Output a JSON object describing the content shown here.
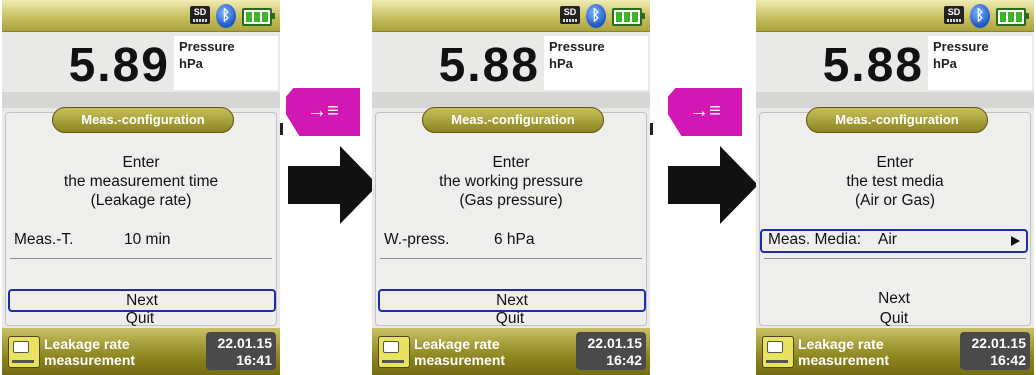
{
  "screens": [
    {
      "reading": "5.89",
      "unit_label": "Pressure",
      "unit": "hPa",
      "dialog_title": "Meas.-configuration",
      "prompt_lines": [
        "Enter",
        "the measurement time",
        "(Leakage rate)"
      ],
      "field_label": "Meas.-T.",
      "field_value": "10 min",
      "selected": "next",
      "next_label": "Next",
      "quit_label": "Quit",
      "footer_title_1": "Leakage rate",
      "footer_title_2": "measurement",
      "date": "22.01.15",
      "time": "16:41"
    },
    {
      "reading": "5.88",
      "unit_label": "Pressure",
      "unit": "hPa",
      "dialog_title": "Meas.-configuration",
      "prompt_lines": [
        "Enter",
        "the working pressure",
        "(Gas pressure)"
      ],
      "field_label": "W.-press.",
      "field_value": "6 hPa",
      "selected": "next",
      "next_label": "Next",
      "quit_label": "Quit",
      "footer_title_1": "Leakage rate",
      "footer_title_2": "measurement",
      "date": "22.01.15",
      "time": "16:42"
    },
    {
      "reading": "5.88",
      "unit_label": "Pressure",
      "unit": "hPa",
      "dialog_title": "Meas.-configuration",
      "prompt_lines": [
        "Enter",
        "the test media",
        "(Air or Gas)"
      ],
      "field_label": "Meas. Media:",
      "field_value": "Air",
      "selected": "field",
      "next_label": "Next",
      "quit_label": "Quit",
      "footer_title_1": "Leakage rate",
      "footer_title_2": "measurement",
      "date": "22.01.15",
      "time": "16:42"
    }
  ],
  "status": {
    "sd_label": "SD",
    "bluetooth_icon": "bluetooth-icon",
    "battery_icon": "battery-icon"
  },
  "colors": {
    "accent_olive": "#a59c2f",
    "key_magenta": "#d218b4",
    "selection_blue": "#1d2fa8"
  },
  "key_icon": "arrow-to-list-icon"
}
